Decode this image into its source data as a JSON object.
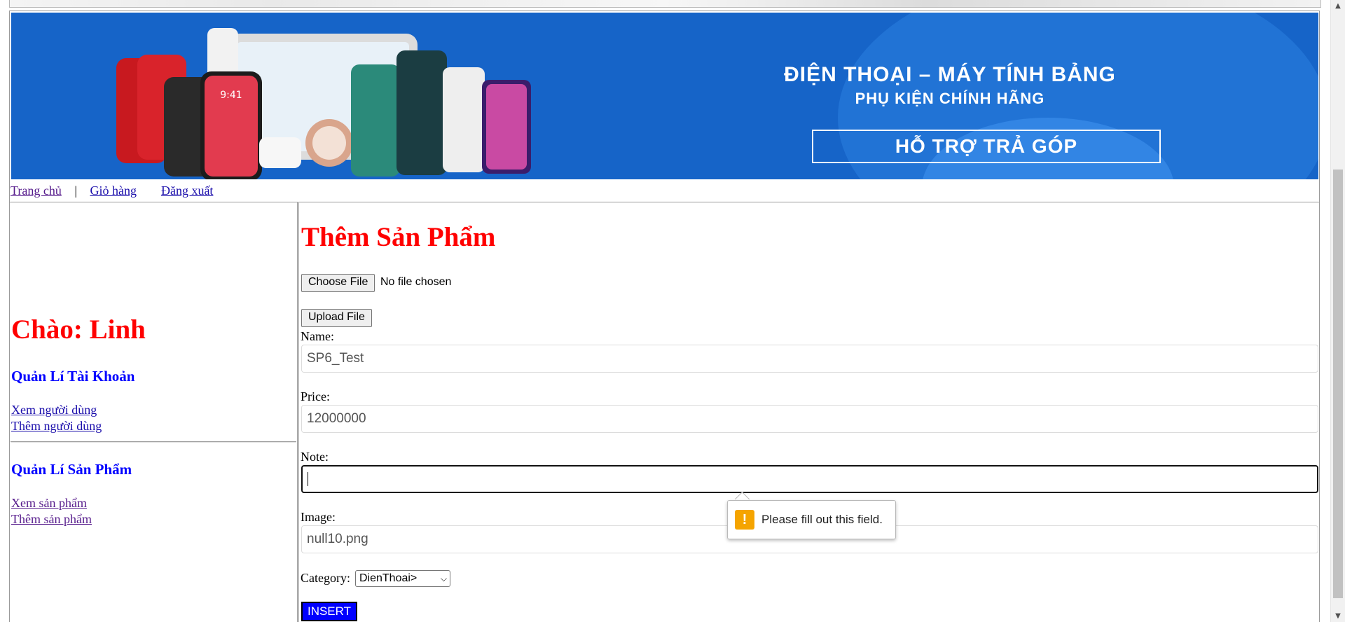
{
  "banner": {
    "line1": "ĐIỆN THOẠI – MÁY TÍNH BẢNG",
    "line2": "PHỤ KIỆN CHÍNH HÃNG",
    "cta": "HỖ TRỢ TRẢ GÓP",
    "phone_screen_time": "9:41",
    "colors": {
      "background": "#1664c8",
      "accent": "#2b7fe0"
    }
  },
  "nav": {
    "home": "Trang chủ",
    "separator": "|",
    "cart": "Giỏ hàng",
    "logout": "Đăng xuất"
  },
  "sidebar": {
    "greeting": "Chào: Linh",
    "account_section": "Quản Lí Tài Khoản",
    "account_links": [
      "Xem người dùng",
      "Thêm người dùng"
    ],
    "product_section": "Quản Lí Sản Phẩm",
    "product_links": [
      "Xem sản phẩm",
      "Thêm sản phẩm"
    ]
  },
  "form": {
    "title": "Thêm Sản Phẩm",
    "choose_file_label": "Choose File",
    "file_status": "No file chosen",
    "upload_label": "Upload File",
    "name_label": "Name:",
    "name_value": "SP6_Test",
    "price_label": "Price:",
    "price_value": "12000000",
    "note_label": "Note:",
    "note_value": "",
    "image_label": "Image:",
    "image_value": "null10.png",
    "category_label": "Category:",
    "category_selected": "DienThoai>",
    "insert_label": "INSERT",
    "validation_message": "Please fill out this field.",
    "warning_icon": "!"
  },
  "colors": {
    "title_red": "#ff0000",
    "section_blue": "#0000ff",
    "insert_button": "#0000ff",
    "warning": "#f5a400"
  }
}
